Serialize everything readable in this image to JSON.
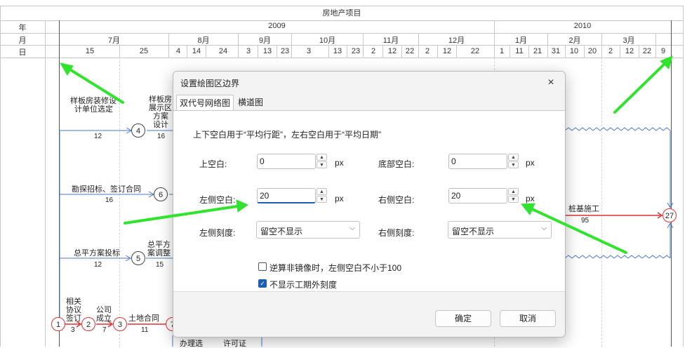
{
  "project_title": "房地产项目",
  "row_labels": {
    "year": "年",
    "month": "月",
    "day": "日"
  },
  "years": [
    "2009",
    "2010"
  ],
  "months": [
    "7月",
    "8月",
    "9月",
    "10月",
    "11月",
    "12月",
    "1月",
    "2月",
    "3月"
  ],
  "days": [
    "15",
    "25",
    "4",
    "14",
    "24",
    "3",
    "13",
    "23",
    "3",
    "13",
    "23",
    "2",
    "12",
    "22",
    "2",
    "12",
    "22",
    "1",
    "11",
    "21",
    "31",
    "10",
    "20",
    "2",
    "12",
    "22",
    "9"
  ],
  "network": {
    "tasks": [
      {
        "label": "样板房装修设",
        "label2": "计单位选定",
        "duration": "12"
      },
      {
        "label": "样板房",
        "label2": "展示区",
        "label3": "方案",
        "label4": "设计",
        "duration": "16"
      },
      {
        "label": "勘探招标、签订合同",
        "duration": "16"
      },
      {
        "label": "总平方案投标",
        "duration": "12"
      },
      {
        "label": "总平方",
        "label2": "案调整",
        "duration": "15"
      },
      {
        "label": "相关",
        "label2": "协议",
        "label3": "签订",
        "duration": "3"
      },
      {
        "label": "公司",
        "label2": "成立",
        "duration": "7"
      },
      {
        "label": "土地合同",
        "duration": "11"
      },
      {
        "label": "桩基施工",
        "duration": "95"
      },
      {
        "label": "办理选"
      },
      {
        "label": "许可证"
      }
    ],
    "nodes": [
      "1",
      "2",
      "3",
      "4",
      "5",
      "6",
      "7",
      "27"
    ]
  },
  "dialog": {
    "title": "设置绘图区边界",
    "close_icon": "×",
    "tabs": [
      "双代号网络图",
      "横道图"
    ],
    "description": "上下空白用于“平均行距”，左右空白用于“平均日期”",
    "fields": {
      "top": {
        "label": "上空白:",
        "value": "0",
        "unit": "px"
      },
      "bottom": {
        "label": "底部空白:",
        "value": "0",
        "unit": "px"
      },
      "left": {
        "label": "左侧空白:",
        "value": "20",
        "unit": "px"
      },
      "right": {
        "label": "右侧空白:",
        "value": "20",
        "unit": "px"
      },
      "left_scale": {
        "label": "左侧刻度:",
        "value": "留空不显示"
      },
      "right_scale": {
        "label": "右侧刻度:",
        "value": "留空不显示"
      }
    },
    "checkboxes": [
      {
        "label": "逆算非镜像时，左侧空白不小于100",
        "checked": false
      },
      {
        "label": "不显示工期外刻度",
        "checked": true
      }
    ],
    "buttons": {
      "ok": "确定",
      "cancel": "取消"
    }
  },
  "colors": {
    "arrow": "#31e32f",
    "red_line": "#dd3333",
    "blue_line": "#4a78c8",
    "accent": "#1a5fb4"
  }
}
